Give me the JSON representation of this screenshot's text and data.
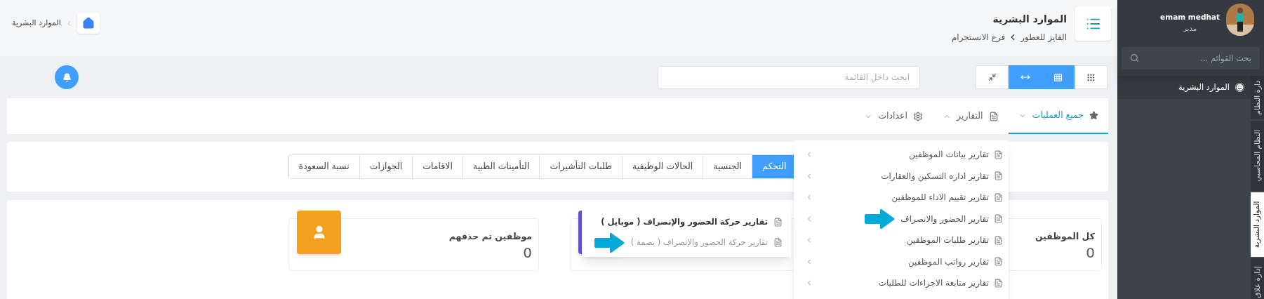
{
  "header": {
    "title": "الموارد البشرية",
    "breadcrumb": [
      "الفايز للعطور",
      "فرع الانستجرام"
    ],
    "home_breadcrumb": "الموارد البشرية"
  },
  "toolbar": {
    "view_buttons": [
      {
        "kind": "dots",
        "selected": false
      },
      {
        "kind": "grid",
        "selected": true
      },
      {
        "kind": "expand",
        "selected": true
      },
      {
        "kind": "compress",
        "selected": false
      }
    ],
    "search": {
      "placeholder": "ابحث داخل القائمة"
    }
  },
  "menu_tabs": [
    {
      "kind": "favorites",
      "label": "جميع العمليات",
      "selected": true,
      "expanded": false
    },
    {
      "kind": "reports",
      "label": "التقارير",
      "selected": false,
      "expanded": true
    },
    {
      "kind": "settings",
      "label": "اعدادات",
      "selected": false,
      "expanded": false
    }
  ],
  "section_tabs": [
    {
      "label": "التحكم",
      "selected": true
    },
    {
      "label": "الجنسية",
      "selected": false
    },
    {
      "label": "الحالات الوظيفية",
      "selected": false
    },
    {
      "label": "طلبات التأشيرات",
      "selected": false
    },
    {
      "label": "التأمينات الطبية",
      "selected": false
    },
    {
      "label": "الاقامات",
      "selected": false
    },
    {
      "label": "الجوازات",
      "selected": false
    },
    {
      "label": "نسبة السعودة",
      "selected": false
    }
  ],
  "stat_cards": [
    {
      "title": "كل الموظفين",
      "value": "0"
    },
    {
      "color": "#6a50d8"
    },
    {
      "title": "موظفين تم حذفهم",
      "value": "0",
      "color": "#f5a01f",
      "kind": "user"
    }
  ],
  "reports_menu": {
    "items": [
      {
        "label": "تقارير بيانات الموظفين",
        "marked": false
      },
      {
        "label": "تقارير اداره التسكين والعقارات",
        "marked": false
      },
      {
        "label": "تقارير تقييم الاداء للموظفين",
        "marked": false
      },
      {
        "label": "تقارير الحضور والانصراف",
        "marked": true
      },
      {
        "label": "تقارير طلبات الموظفين",
        "marked": false
      },
      {
        "label": "تقارير رواتب الموظفين",
        "marked": false
      },
      {
        "label": "تقارير متابعة الاجراءات للطلبات",
        "marked": false
      }
    ]
  },
  "reports_submenu": {
    "items": [
      {
        "label": "تقارير حركة الحضور والإنصراف ( موبايل )",
        "dimmed": false,
        "marked": false
      },
      {
        "label": "تقارير حركة الحضور والإنصراف ( بصمة )",
        "dimmed": true,
        "marked": true
      }
    ]
  },
  "sidebar": {
    "user": {
      "name": "emam medhat",
      "role": "مدير"
    },
    "search": {
      "placeholder": "بحث القوائم ..."
    },
    "items": [
      {
        "label": "الموارد البشرية"
      }
    ],
    "tabs": [
      {
        "label": "دارة النظام",
        "selected": false
      },
      {
        "label": "النظام المحاسبي",
        "selected": false
      },
      {
        "label": "الموارد البشرية",
        "selected": true
      },
      {
        "label": "إدارة علاق",
        "selected": false
      }
    ]
  }
}
